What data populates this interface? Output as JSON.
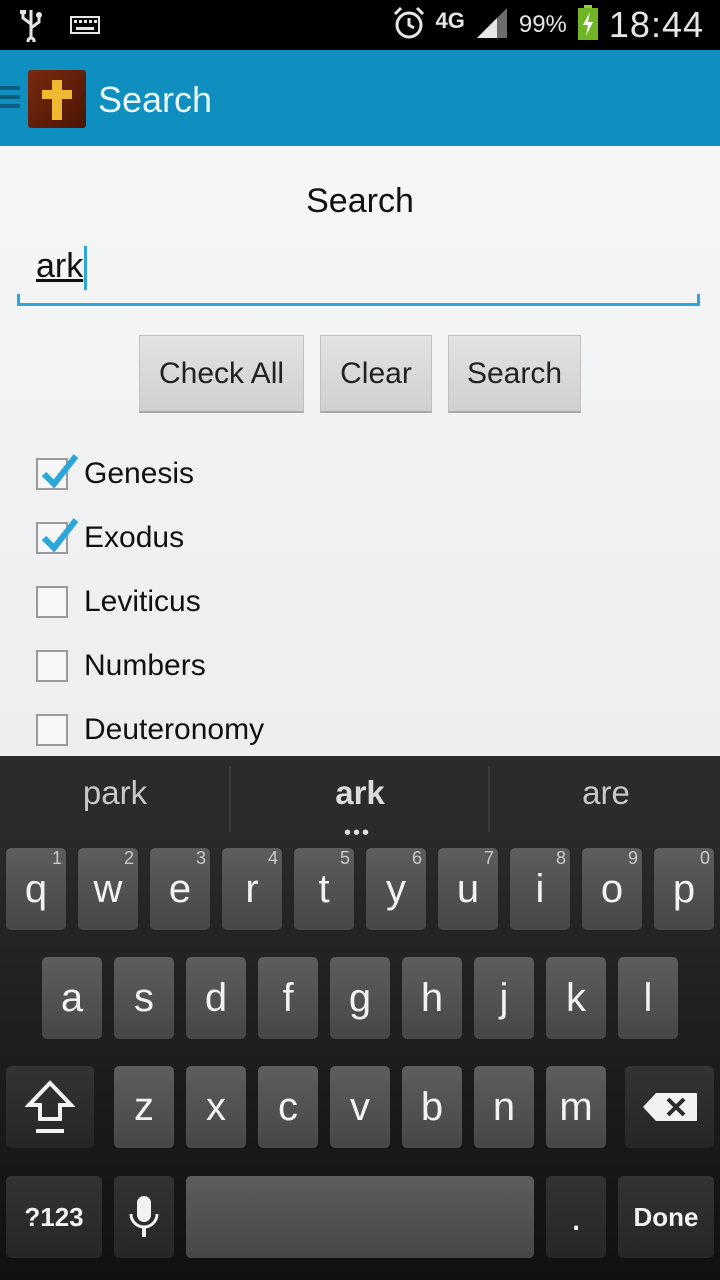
{
  "status_bar": {
    "icons": [
      "usb-icon",
      "keyboard-icon",
      "alarm-icon",
      "signal-icon",
      "battery-charging-icon"
    ],
    "network": "4G",
    "battery_percent": "99%",
    "time": "18:44"
  },
  "action_bar": {
    "title": "Search",
    "app_icon": "cross-icon"
  },
  "form": {
    "heading": "Search",
    "query": "ark",
    "buttons": {
      "check_all": "Check All",
      "clear": "Clear",
      "search": "Search"
    }
  },
  "books": [
    {
      "label": "Genesis",
      "checked": true
    },
    {
      "label": "Exodus",
      "checked": true
    },
    {
      "label": "Leviticus",
      "checked": false
    },
    {
      "label": "Numbers",
      "checked": false
    },
    {
      "label": "Deuteronomy",
      "checked": false
    }
  ],
  "keyboard": {
    "suggestions": [
      "park",
      "ark",
      "are"
    ],
    "row1": [
      {
        "k": "q",
        "n": "1"
      },
      {
        "k": "w",
        "n": "2"
      },
      {
        "k": "e",
        "n": "3"
      },
      {
        "k": "r",
        "n": "4"
      },
      {
        "k": "t",
        "n": "5"
      },
      {
        "k": "y",
        "n": "6"
      },
      {
        "k": "u",
        "n": "7"
      },
      {
        "k": "i",
        "n": "8"
      },
      {
        "k": "o",
        "n": "9"
      },
      {
        "k": "p",
        "n": "0"
      }
    ],
    "row2": [
      "a",
      "s",
      "d",
      "f",
      "g",
      "h",
      "j",
      "k",
      "l"
    ],
    "row3": [
      "z",
      "x",
      "c",
      "v",
      "b",
      "n",
      "m"
    ],
    "symbols_label": "?123",
    "period_label": ".",
    "done_label": "Done"
  },
  "colors": {
    "action_bar": "#0e8fbf",
    "accent": "#2aa7d8",
    "check": "#2aa7d8"
  }
}
